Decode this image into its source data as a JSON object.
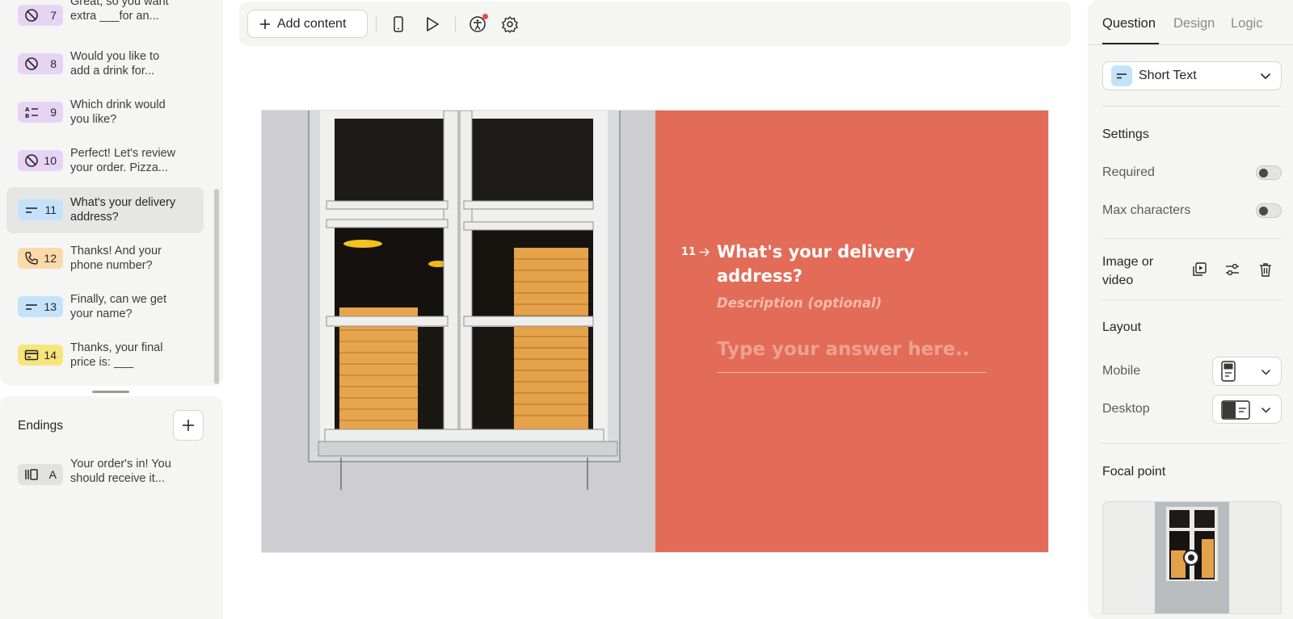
{
  "questions": [
    {
      "num": "7",
      "line1": "Great, so you want",
      "line2": "extra ___for an...",
      "icon": "no-symbol-icon",
      "color": "purple"
    },
    {
      "num": "8",
      "line1": "Would you like to",
      "line2": "add a drink for...",
      "icon": "no-symbol-icon",
      "color": "purple"
    },
    {
      "num": "9",
      "line1": "Which drink would",
      "line2": "you like?",
      "icon": "ab-list-icon",
      "color": "purple"
    },
    {
      "num": "10",
      "line1": "Perfect! Let's review",
      "line2": "your order. Pizza...",
      "icon": "no-symbol-icon",
      "color": "purple"
    },
    {
      "num": "11",
      "line1": "What's your delivery",
      "line2": "address?",
      "icon": "short-text-icon",
      "color": "blue",
      "active": true
    },
    {
      "num": "12",
      "line1": "Thanks! And your",
      "line2": "phone number?",
      "icon": "phone-icon",
      "color": "orange"
    },
    {
      "num": "13",
      "line1": "Finally, can we get",
      "line2": "your name?",
      "icon": "short-text-icon",
      "color": "blue"
    },
    {
      "num": "14",
      "line1": "Thanks, your final",
      "line2": "price is: ___",
      "icon": "payment-card-icon",
      "color": "yellow"
    }
  ],
  "endings": {
    "title": "Endings",
    "items": [
      {
        "letter": "A",
        "line1": "Your order's in! You",
        "line2": "should receive it...",
        "icon": "ending-icon"
      }
    ]
  },
  "toolbar": {
    "add_content_label": "Add content"
  },
  "canvas": {
    "question_number": "11",
    "question_title_line1": "What's your delivery",
    "question_title_line2": "address?",
    "description_placeholder": "Description (optional)",
    "answer_placeholder": "Type your answer here..",
    "form_background": "#e26c58"
  },
  "right_panel": {
    "tabs": [
      {
        "label": "Question",
        "active": true
      },
      {
        "label": "Design",
        "active": false
      },
      {
        "label": "Logic",
        "active": false
      }
    ],
    "question_type": "Short Text",
    "settings_title": "Settings",
    "required_label": "Required",
    "required_on": false,
    "max_characters_label": "Max characters",
    "max_characters_on": false,
    "image_or_video_label_1": "Image or",
    "image_or_video_label_2": "video",
    "layout_title": "Layout",
    "mobile_label": "Mobile",
    "desktop_label": "Desktop",
    "focal_point_title": "Focal point"
  },
  "colors": {
    "accent_question_blue": "#c4e3fb",
    "accent_purple": "#e8d3f5",
    "accent_orange": "#fbd9aa",
    "accent_yellow": "#f7e57c",
    "notification_red": "#e34f3b"
  }
}
